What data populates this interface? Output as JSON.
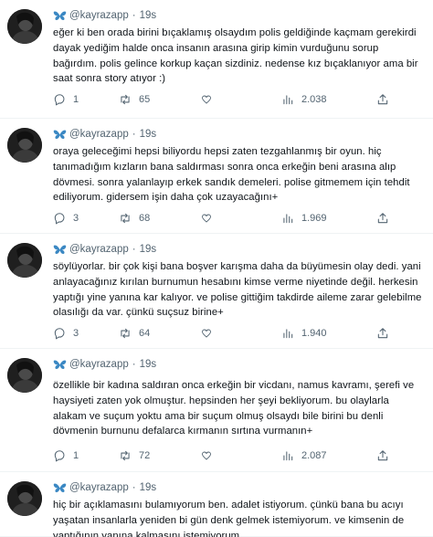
{
  "tweets": [
    {
      "handle": "@kayrazapp",
      "time": "19s",
      "text": "eğer ki ben orada birini bıçaklamış olsaydım polis geldiğinde kaçmam gerekirdi dayak yediğim halde onca insanın arasına girip kimin vurduğunu sorup bağırdım. polis gelince korkup kaçan sizdiniz. nedense kız bıçaklanıyor ama bir saat sonra story atıyor :)",
      "replies": "1",
      "retweets": "65",
      "views": "2.038"
    },
    {
      "handle": "@kayrazapp",
      "time": "19s",
      "text": "oraya geleceğimi hepsi biliyordu hepsi zaten tezgahlanmış bir oyun. hiç tanımadığım kızların bana saldırması sonra onca erkeğin beni arasına alıp dövmesi. sonra yalanlayıp erkek sandık demeleri. polise gitmemem için tehdit ediliyorum. gidersem işin daha çok uzayacağını+",
      "replies": "3",
      "retweets": "68",
      "views": "1.969"
    },
    {
      "handle": "@kayrazapp",
      "time": "19s",
      "text": "söylüyorlar. bir çok kişi bana boşver karışma daha da büyümesin olay dedi. yani anlayacağınız kırılan burnumun hesabını kimse verme niyetinde değil. herkesin yaptığı yine yanına kar kalıyor. ve polise gittiğim takdirde aileme zarar gelebilme olasılığı da var. çünkü suçsuz birine+",
      "replies": "3",
      "retweets": "64",
      "views": "1.940"
    },
    {
      "handle": "@kayrazapp",
      "time": "19s",
      "text": "özellikle bir kadına saldıran onca erkeğin bir vicdanı, namus kavramı, şerefi ve haysiyeti zaten yok olmuştur. hepsinden her şeyi bekliyorum. bu olaylarla alakam ve suçum yoktu ama bir suçum olmuş olsaydı bile birini bu denli dövmenin burnunu defalarca kırmanın sırtına vurmanın+",
      "replies": "1",
      "retweets": "72",
      "views": "2.087"
    },
    {
      "handle": "@kayrazapp",
      "time": "19s",
      "text": "hiç bir açıklamasını bulamıyorum ben. adalet istiyorum. çünkü bana bu acıyı yaşatan insanlarla yeniden bi gün denk gelmek istemiyorum. ve kimsenin de yaptığının yanına kalmasını istemiyorum."
    }
  ],
  "colors": {
    "muted": "#536471",
    "text": "#0f1419",
    "butterfly": "#3b88c3",
    "divider": "#eff3f4"
  },
  "icons": {
    "reply": "reply-icon",
    "retweet": "retweet-icon",
    "like": "heart-icon",
    "views": "views-icon",
    "share": "share-icon",
    "badge": "butterfly-icon"
  }
}
